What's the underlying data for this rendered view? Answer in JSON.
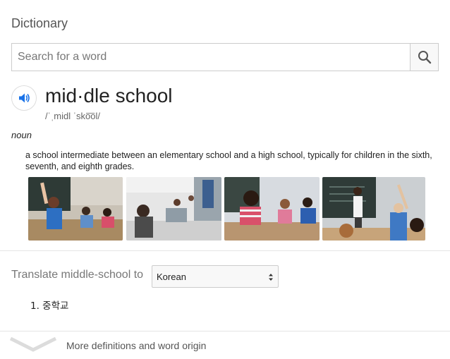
{
  "header": {
    "title": "Dictionary"
  },
  "search": {
    "placeholder": "Search for a word",
    "icon": "search-icon"
  },
  "entry": {
    "headword": "mid·dle school",
    "pronunciation": "/ˈˌmidl ˈsko͞ol/",
    "part_of_speech": "noun",
    "definition": "a school intermediate between an elementary school and a high school, typically for children in the sixth, seventh, and eighth grades."
  },
  "images": [
    {
      "icon": "classroom-photo"
    },
    {
      "icon": "classroom-photo"
    },
    {
      "icon": "classroom-photo"
    },
    {
      "icon": "classroom-photo"
    }
  ],
  "translate": {
    "label": "Translate middle-school to",
    "selected_language": "Korean",
    "results": [
      "1. 중학교"
    ]
  },
  "footer": {
    "more_label": "More definitions and word origin"
  },
  "colors": {
    "accent": "#1a73e8",
    "divider": "#e5e5e5"
  }
}
